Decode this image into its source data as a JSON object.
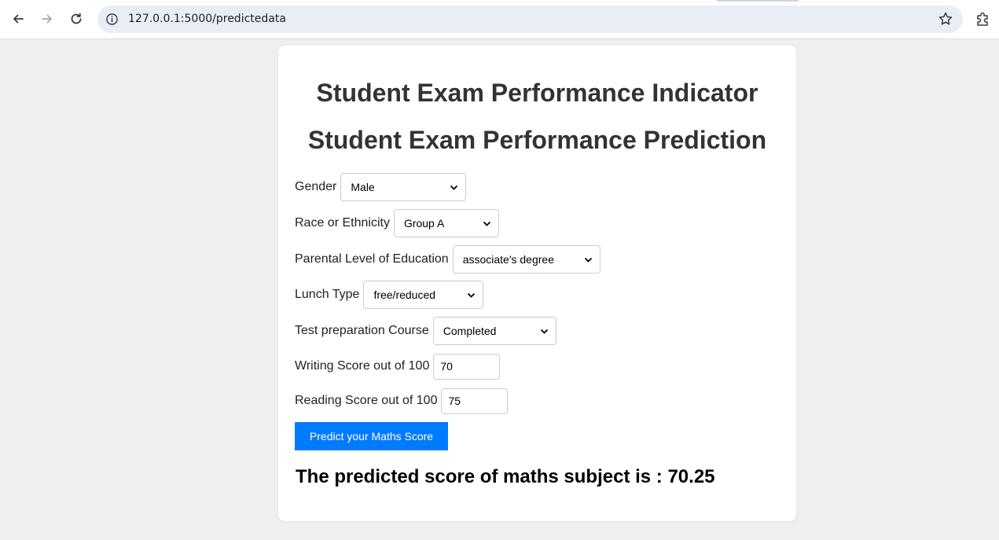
{
  "browser": {
    "url": "127.0.0.1:5000/predictedata"
  },
  "page": {
    "title1": "Student Exam Performance Indicator",
    "title2": "Student Exam Performance Prediction"
  },
  "form": {
    "gender": {
      "label": "Gender",
      "value": "Male"
    },
    "race": {
      "label": "Race or Ethnicity",
      "value": "Group A"
    },
    "parental": {
      "label": "Parental Level of Education",
      "value": "associate's degree"
    },
    "lunch": {
      "label": "Lunch Type",
      "value": "free/reduced"
    },
    "test_prep": {
      "label": "Test preparation Course",
      "value": "Completed"
    },
    "writing": {
      "label": "Writing Score out of 100",
      "value": "70"
    },
    "reading": {
      "label": "Reading Score out of 100",
      "value": "75"
    },
    "submit_label": "Predict your Maths Score"
  },
  "result": {
    "text": "The predicted score of maths subject is : 70.25"
  },
  "colors": {
    "button": "#007bff",
    "page_bg": "#efefef",
    "heading": "#333333"
  }
}
